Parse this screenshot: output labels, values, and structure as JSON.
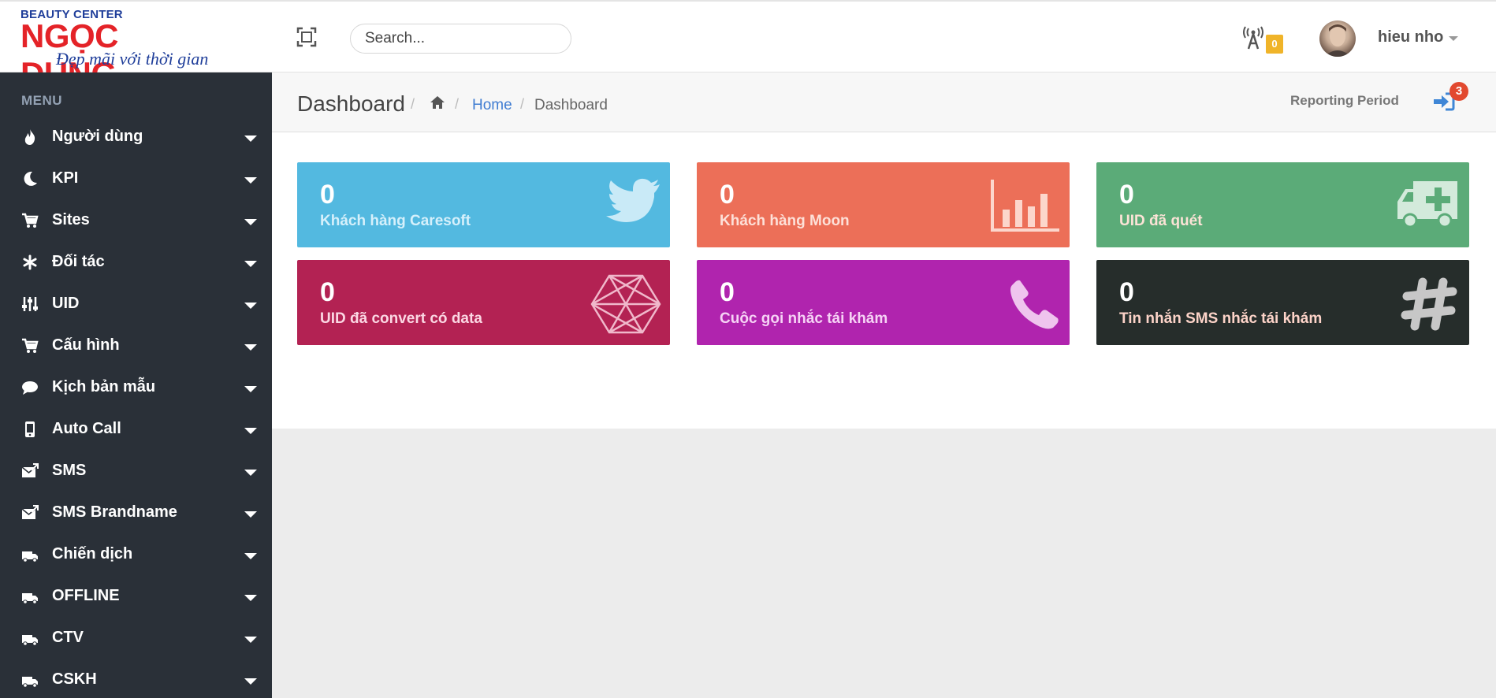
{
  "brand": {
    "top": "BEAUTY CENTER",
    "main": "NGỌC DUNG",
    "tagline": "Đẹp mãi với thời gian"
  },
  "header": {
    "search_placeholder": "Search...",
    "notifications_count": "0",
    "user_name": "hieu nho"
  },
  "sidebar": {
    "header": "MENU",
    "items": [
      {
        "label": "Người dùng",
        "icon": "fire-icon"
      },
      {
        "label": "KPI",
        "icon": "moon-icon"
      },
      {
        "label": "Sites",
        "icon": "cart-icon"
      },
      {
        "label": "Đối tác",
        "icon": "asterisk-icon"
      },
      {
        "label": "UID",
        "icon": "sliders-icon"
      },
      {
        "label": "Cấu hình",
        "icon": "cart-icon"
      },
      {
        "label": "Kịch bản mẫu",
        "icon": "comment-icon"
      },
      {
        "label": "Auto Call",
        "icon": "mobile-icon"
      },
      {
        "label": "SMS",
        "icon": "envelope-icon"
      },
      {
        "label": "SMS Brandname",
        "icon": "envelope-icon"
      },
      {
        "label": "Chiến dịch",
        "icon": "truck-icon"
      },
      {
        "label": "OFFLINE",
        "icon": "truck-icon"
      },
      {
        "label": "CTV",
        "icon": "truck-icon"
      },
      {
        "label": "CSKH",
        "icon": "truck-icon"
      }
    ]
  },
  "page": {
    "title": "Dashboard",
    "breadcrumb_home": "Home",
    "breadcrumb_current": "Dashboard",
    "reporting_period": "Reporting Period",
    "signin_badge": "3"
  },
  "tiles": [
    {
      "value": "0",
      "label": "Khách hàng Caresoft",
      "color": "#53b9e0",
      "label_color": "#d5f0fb",
      "icon": "twitter-icon"
    },
    {
      "value": "0",
      "label": "Khách hàng Moon",
      "color": "#ec6f58",
      "label_color": "#fde0d8",
      "icon": "bar-chart-icon"
    },
    {
      "value": "0",
      "label": "UID đã quét",
      "color": "#5bab78",
      "label_color": "#fbe3d6",
      "icon": "ambulance-icon"
    },
    {
      "value": "0",
      "label": "UID đã convert có data",
      "color": "#b32253",
      "label_color": "#fbd7e3",
      "icon": "polygon-network-icon"
    },
    {
      "value": "0",
      "label": "Cuộc gọi nhắc tái khám",
      "color": "#b024ae",
      "label_color": "#f6d2f5",
      "icon": "phone-icon"
    },
    {
      "value": "0",
      "label": "Tin nhắn SMS nhắc tái khám",
      "color": "#262d2b",
      "label_color": "#fcd3c8",
      "icon": "hashtag-icon"
    }
  ]
}
